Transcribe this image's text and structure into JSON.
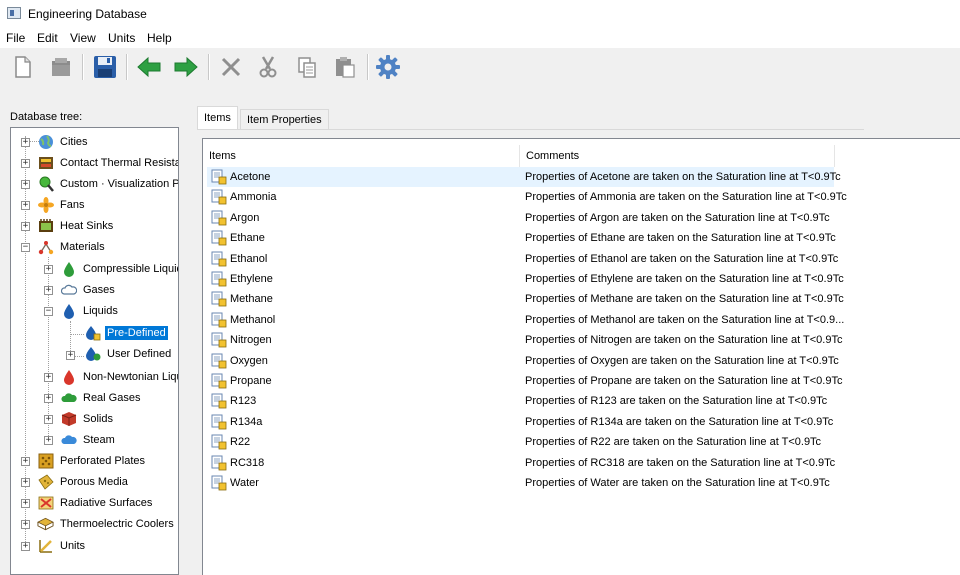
{
  "window": {
    "title": "Engineering Database"
  },
  "menu": [
    "File",
    "Edit",
    "View",
    "Units",
    "Help"
  ],
  "toolbar": {
    "buttons": [
      "new-icon",
      "open-icon",
      "save-icon",
      "back-arrow-icon",
      "forward-arrow-icon",
      "delete-icon",
      "cut-icon",
      "copy-icon",
      "paste-icon",
      "settings-gear-icon"
    ]
  },
  "tree": {
    "label": "Database tree:",
    "nodes": {
      "cities": "Cities",
      "contact": "Contact Thermal Resistar",
      "custom": "Custom · Visualization Pa",
      "fans": "Fans",
      "heatsinks": "Heat Sinks",
      "materials": "Materials",
      "compressible": "Compressible Liquids",
      "gases": "Gases",
      "liquids": "Liquids",
      "predefined": "Pre-Defined",
      "userdefined": "User Defined",
      "nonnewtonian": "Non-Newtonian Liqu",
      "realgases": "Real Gases",
      "solids": "Solids",
      "steam": "Steam",
      "perforated": "Perforated Plates",
      "porous": "Porous Media",
      "radiative": "Radiative Surfaces",
      "thermoelectric": "Thermoelectric Coolers",
      "units": "Units"
    },
    "selected": "Pre-Defined"
  },
  "tabs": {
    "items": "Items",
    "properties": "Item Properties"
  },
  "list": {
    "columns": {
      "items": "Items",
      "comments": "Comments"
    },
    "rows": [
      {
        "name": "Acetone",
        "comment": "Properties of Acetone are taken on the Saturation line at T<0.9Tc"
      },
      {
        "name": "Ammonia",
        "comment": "Properties of Ammonia are taken on the Saturation line at T<0.9Tc"
      },
      {
        "name": "Argon",
        "comment": "Properties of Argon are taken on the Saturation line at T<0.9Tc"
      },
      {
        "name": "Ethane",
        "comment": "Properties of Ethane are taken on the Saturation line at T<0.9Tc"
      },
      {
        "name": "Ethanol",
        "comment": "Properties of Ethanol are taken on the Saturation line at T<0.9Tc"
      },
      {
        "name": "Ethylene",
        "comment": "Properties of Ethylene are taken on the Saturation line at T<0.9Tc"
      },
      {
        "name": "Methane",
        "comment": "Properties of Methane are taken on the Saturation line at T<0.9Tc"
      },
      {
        "name": "Methanol",
        "comment": "Properties of Methanol are taken on the Saturation line at T<0.9..."
      },
      {
        "name": "Nitrogen",
        "comment": "Properties of Nitrogen are taken on the Saturation line at T<0.9Tc"
      },
      {
        "name": "Oxygen",
        "comment": "Properties of Oxygen are taken on the Saturation line at T<0.9Tc"
      },
      {
        "name": "Propane",
        "comment": "Properties of Propane are taken on the Saturation line at T<0.9Tc"
      },
      {
        "name": "R123",
        "comment": "Properties of R123 are taken on the Saturation line at T<0.9Tc"
      },
      {
        "name": "R134a",
        "comment": "Properties of R134a are taken on the Saturation line at T<0.9Tc"
      },
      {
        "name": "R22",
        "comment": "Properties of R22 are taken on the Saturation line at T<0.9Tc"
      },
      {
        "name": "RC318",
        "comment": "Properties of RC318 are taken on the Saturation line at T<0.9Tc"
      },
      {
        "name": "Water",
        "comment": "Properties of Water are taken on the Saturation line at T<0.9Tc"
      }
    ]
  },
  "colors": {
    "selection": "#0078d7",
    "hover_row": "#e5f3ff",
    "arrow_green": "#2ea043",
    "save_blue": "#2a5ea8"
  }
}
